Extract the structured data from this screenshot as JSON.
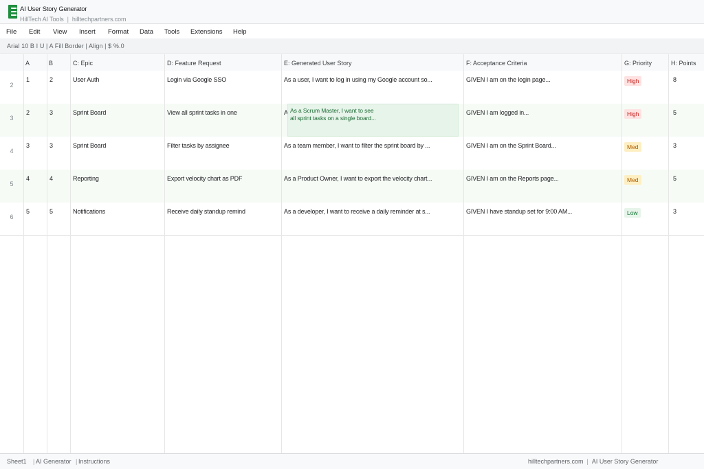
{
  "window": {
    "title": "AI User Story Generator",
    "org": "HillTech AI Tools",
    "separator": "|",
    "site": "hilltechpartners.com"
  },
  "menu": [
    "File",
    "Edit",
    "View",
    "Insert",
    "Format",
    "Data",
    "Tools",
    "Extensions",
    "Help"
  ],
  "toolbar": {
    "text": "Arial  10  B I U | A Fill Border | Align | $ %.0"
  },
  "columns": {
    "a": "A",
    "b": "B",
    "c": "C: Epic",
    "d": "D: Feature Request",
    "e": "E: Generated User Story",
    "f": "F: Acceptance Criteria",
    "g": "G: Priority",
    "h": "H: Points"
  },
  "rows": [
    {
      "num": "2",
      "a": "1",
      "b": "2",
      "epic": "User Auth",
      "feature": "Login via Google SSO",
      "story": "As a user, I want to log in using my Google account so...",
      "criteria": "GIVEN I am on the login page...",
      "priority": "High",
      "points": "8"
    },
    {
      "num": "3",
      "a": "2",
      "b": "3",
      "epic": "Sprint Board",
      "feature": "View all sprint tasks in one",
      "story": "A",
      "criteria": "GIVEN I am logged in...",
      "priority": "High",
      "points": "5"
    },
    {
      "num": "4",
      "a": "3",
      "b": "3",
      "epic": "Sprint Board",
      "feature": "Filter tasks by assignee",
      "story": "As a team member, I want to filter the sprint board by ...",
      "criteria": "GIVEN I am on the Sprint Board...",
      "priority": "Med",
      "points": "3"
    },
    {
      "num": "5",
      "a": "4",
      "b": "4",
      "epic": "Reporting",
      "feature": "Export velocity chart as PDF",
      "story": "As a Product Owner, I want to export the velocity chart...",
      "criteria": "GIVEN I am on the Reports page...",
      "priority": "Med",
      "points": "5"
    },
    {
      "num": "6",
      "a": "5",
      "b": "5",
      "epic": "Notifications",
      "feature": "Receive daily standup remind",
      "story": "As a developer, I want to receive a daily reminder at s...",
      "criteria": "GIVEN I have standup set for 9:00 AM...",
      "priority": "Low",
      "points": "3"
    }
  ],
  "editing_cell": {
    "line1": "As a Scrum Master, I want to see",
    "line2": "all sprint tasks on a single board..."
  },
  "sheets": [
    "Sheet1",
    "AI Generator",
    "Instructions"
  ],
  "status": {
    "site": "hilltechpartners.com",
    "app": "AI User Story Generator"
  },
  "colors": {
    "brand": "#1e8e3e",
    "high": "#c5221f",
    "med": "#b06000",
    "low": "#137333"
  }
}
